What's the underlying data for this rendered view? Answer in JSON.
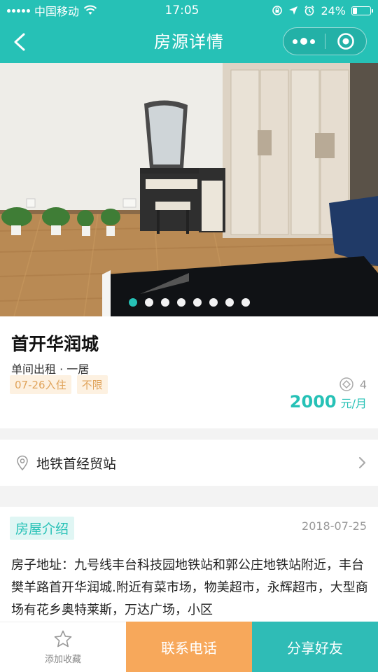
{
  "status_bar": {
    "carrier": "中国移动",
    "time": "17:05",
    "battery": "24%",
    "battery_level": 0.24,
    "icons": [
      "signal-icon",
      "wifi-icon",
      "rotation-lock-icon",
      "location-icon",
      "alarm-icon",
      "battery-icon"
    ]
  },
  "nav": {
    "title": "房源详情",
    "back_icon": "chevron-left-icon",
    "more_icon": "more-dots-icon",
    "close_icon": "target-circle-icon"
  },
  "gallery": {
    "page_count": 8,
    "current_page": 1
  },
  "listing": {
    "name": "首开华润城",
    "type": "单间出租 · 一居",
    "tags": [
      "07-26入住",
      "不限"
    ],
    "views": "4",
    "price": "2000",
    "price_unit": "元/月"
  },
  "location": {
    "text": "地铁首经贸站",
    "icon": "map-pin-icon"
  },
  "intro": {
    "heading": "房屋介绍",
    "date": "2018-07-25",
    "text": "房子地址：九号线丰台科技园地铁站和郭公庄地铁站附近，丰台樊羊路首开华润城.附近有菜市场，物美超市，永辉超市，大型商场有花乡奥特莱斯，万达广场，小区"
  },
  "bottom_bar": {
    "favorite_label": "添加收藏",
    "call_label": "联系电话",
    "share_label": "分享好友"
  },
  "colors": {
    "brand": "#26c1b6",
    "price": "#26c1b6",
    "call_button": "#f7a85b",
    "share_button": "#2fbcb6",
    "tag_text": "#e0a35a"
  }
}
